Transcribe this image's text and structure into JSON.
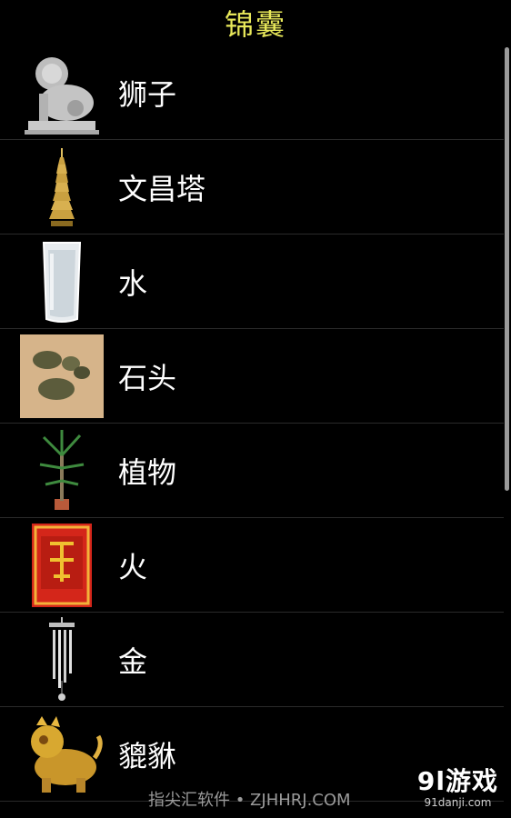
{
  "header": {
    "title": "锦囊"
  },
  "items": [
    {
      "label": "狮子",
      "icon": "stone-lion-icon"
    },
    {
      "label": "文昌塔",
      "icon": "pagoda-icon"
    },
    {
      "label": "水",
      "icon": "water-glass-icon"
    },
    {
      "label": "石头",
      "icon": "stones-icon"
    },
    {
      "label": "植物",
      "icon": "potted-plant-icon"
    },
    {
      "label": "火",
      "icon": "red-fire-charm-icon"
    },
    {
      "label": "金",
      "icon": "wind-chime-icon"
    },
    {
      "label": "貔貅",
      "icon": "golden-pixiu-icon"
    }
  ],
  "watermark": {
    "text": "指尖汇软件 • ZJHHRJ.COM"
  },
  "logo": {
    "main": "9l游戏",
    "sub": "91danji.com"
  },
  "colors": {
    "title": "#e8e85a",
    "background": "#000000",
    "label": "#ffffff"
  }
}
